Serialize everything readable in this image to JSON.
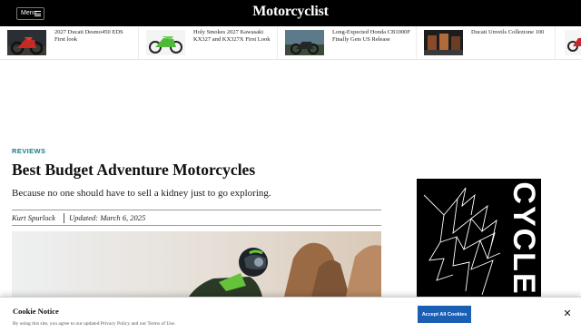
{
  "header": {
    "menu_label": "Menu",
    "logo": "Motorcyclist"
  },
  "trending": [
    {
      "title": "2027 Ducati Desmo450 EDS First look"
    },
    {
      "title": "Holy Smokes 2027 Kawasaki KX327 and KX327X First Look"
    },
    {
      "title": "Long-Expected Honda CB1000F Finally Gets US Release"
    },
    {
      "title": "Ducati Unveils Collezione 100"
    }
  ],
  "article": {
    "kicker": "REVIEWS",
    "headline": "Best Budget Adventure Motorcycles",
    "dek": "Because no one should have to sell a kidney just to go exploring.",
    "author": "Kurt Spurlock",
    "updated": "Updated: March 6, 2025"
  },
  "side_ad": {
    "brand": "CYCLE"
  },
  "cookie": {
    "title": "Cookie Notice",
    "text_prefix": "By using this site, you agree to our updated ",
    "privacy_link": "Privacy Policy",
    "text_middle": " and our ",
    "terms_link": "Terms of Use",
    "text_suffix": ".",
    "accept_label": "Accept All Cookies",
    "close_glyph": "✕"
  },
  "colors": {
    "header_bg": "#000000",
    "kicker": "#1a7a86",
    "accept_button": "#1a5fb4"
  }
}
